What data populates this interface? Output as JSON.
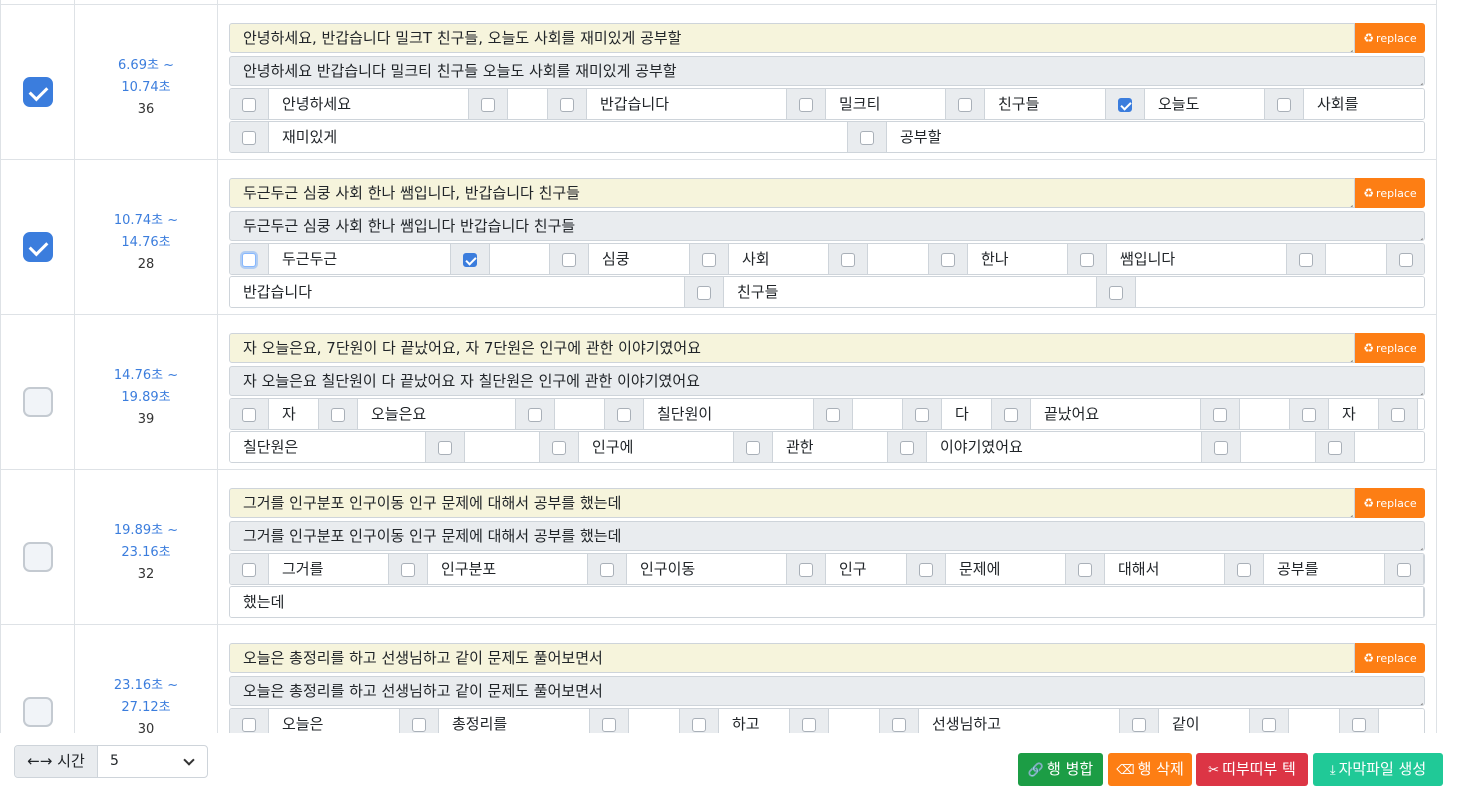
{
  "replace_label": "replace",
  "rows": [
    {
      "checked": false,
      "time_range": "",
      "count": "",
      "source": "",
      "edited": "",
      "lines": []
    },
    {
      "checked": true,
      "time_range": "6.69초 ~",
      "time_end": "10.74초",
      "count": "36",
      "source": "안녕하세요, 반갑습니다 밀크T 친구들, 오늘도 사회를 재미있게 공부할",
      "edited": "안녕하세요 반갑습니다 밀크티 친구들 오늘도 사회를 재미있게 공부할",
      "lines": [
        [
          {
            "w": "안녕하세요",
            "c": false,
            "width": 200
          },
          {
            "w": "",
            "c": false,
            "width": 40
          },
          {
            "w": "반갑습니다",
            "c": false,
            "width": 200
          },
          {
            "w": "밀크티",
            "c": false,
            "width": 120
          },
          {
            "w": "친구들",
            "c": false,
            "width": 121
          },
          {
            "w": "오늘도",
            "c": true,
            "width": 120
          },
          {
            "w": "사회를",
            "c": false,
            "width": 121
          }
        ],
        [
          {
            "w": "재미있게",
            "c": false,
            "width": 579
          },
          {
            "w": "공부할",
            "c": false,
            "width": 539
          }
        ]
      ]
    },
    {
      "checked": true,
      "time_range": "10.74초 ~",
      "time_end": "14.76초",
      "count": "28",
      "source": "두근두근 심쿵 사회 한나 쌤입니다, 반갑습니다 친구들",
      "edited": "두근두근 심쿵 사회 한나 쌤입니다 반갑습니다 친구들",
      "lines": [
        [
          {
            "w": "두근두근",
            "c": false,
            "focus": true,
            "width": 182
          },
          {
            "w": "",
            "c": true,
            "width": 60
          },
          {
            "w": "심쿵",
            "c": false,
            "width": 101
          },
          {
            "w": "사회",
            "c": false,
            "width": 100
          },
          {
            "w": "",
            "c": false,
            "width": 61
          },
          {
            "w": "한나",
            "c": false,
            "width": 100
          },
          {
            "w": "쌤입니다",
            "c": false,
            "width": 180
          },
          {
            "w": "",
            "c": false,
            "width": 61
          },
          {
            "w": "",
            "c": false,
            "width": 0
          }
        ],
        [
          {
            "w": "반갑습니다",
            "c": null,
            "width": 455
          },
          {
            "w": "친구들",
            "c": false,
            "width": 373
          },
          {
            "w": "",
            "c": false,
            "width": 290
          }
        ]
      ]
    },
    {
      "checked": false,
      "time_range": "14.76초 ~",
      "time_end": "19.89초",
      "count": "39",
      "source": "자 오늘은요, 7단원이 다 끝났어요, 자 7단원은 인구에 관한 이야기였어요",
      "edited": "자 오늘은요 칠단원이 다 끝났어요 자 칠단원은 인구에 관한 이야기였어요",
      "lines": [
        [
          {
            "w": "자",
            "c": false,
            "width": 50
          },
          {
            "w": "오늘은요",
            "c": false,
            "width": 158
          },
          {
            "w": "",
            "c": false,
            "width": 50
          },
          {
            "w": "칠단원이",
            "c": false,
            "width": 170
          },
          {
            "w": "",
            "c": false,
            "width": 50
          },
          {
            "w": "다",
            "c": false,
            "width": 50
          },
          {
            "w": "끝났어요",
            "c": false,
            "width": 170
          },
          {
            "w": "",
            "c": false,
            "width": 50
          },
          {
            "w": "자",
            "c": false,
            "width": 50
          },
          {
            "w": "",
            "c": false,
            "width": 0
          }
        ],
        [
          {
            "w": "칠단원은",
            "c": null,
            "width": 196
          },
          {
            "w": "",
            "c": false,
            "width": 75
          },
          {
            "w": "인구에",
            "c": false,
            "width": 155
          },
          {
            "w": "관한",
            "c": false,
            "width": 115
          },
          {
            "w": "이야기였어요",
            "c": false,
            "width": 275
          },
          {
            "w": "",
            "c": false,
            "width": 75
          },
          {
            "w": "",
            "c": false,
            "width": 75
          }
        ]
      ]
    },
    {
      "checked": false,
      "time_range": "19.89초 ~",
      "time_end": "23.16초",
      "count": "32",
      "source": "그거를 인구분포 인구이동 인구 문제에 대해서 공부를 했는데",
      "edited": "그거를 인구분포 인구이동 인구 문제에 대해서 공부를 했는데",
      "lines": [
        [
          {
            "w": "그거를",
            "c": false,
            "width": 120
          },
          {
            "w": "인구분포",
            "c": false,
            "width": 160
          },
          {
            "w": "인구이동",
            "c": false,
            "width": 160
          },
          {
            "w": "인구",
            "c": false,
            "width": 81
          },
          {
            "w": "문제에",
            "c": false,
            "width": 120
          },
          {
            "w": "대해서",
            "c": false,
            "width": 120
          },
          {
            "w": "공부를",
            "c": false,
            "width": 121
          },
          {
            "w": "",
            "c": false,
            "width": 0
          }
        ],
        [
          {
            "w": "했는데",
            "c": null,
            "width": 1194
          }
        ]
      ]
    },
    {
      "checked": false,
      "time_range": "23.16초 ~",
      "time_end": "27.12초",
      "count": "30",
      "source": "오늘은 총정리를 하고 선생님하고 같이 문제도 풀어보면서",
      "edited": "오늘은 총정리를 하고 선생님하고 같이 문제도 풀어보면서",
      "lines": [
        [
          {
            "w": "오늘은",
            "c": false,
            "width": 131
          },
          {
            "w": "총정리를",
            "c": false,
            "width": 151
          },
          {
            "w": "",
            "c": false,
            "width": 51
          },
          {
            "w": "하고",
            "c": false,
            "width": 71
          },
          {
            "w": "",
            "c": false,
            "width": 51
          },
          {
            "w": "선생님하고",
            "c": false,
            "width": 201
          },
          {
            "w": "같이",
            "c": false,
            "width": 91
          },
          {
            "w": "",
            "c": false,
            "width": 51
          },
          {
            "w": "",
            "c": false,
            "width": 0
          }
        ]
      ]
    }
  ],
  "footer": {
    "time_label": "←→ 시간",
    "time_value": "5",
    "merge_label": "행 병합",
    "delete_label": "행 삭제",
    "beep_label": "띠부띠부 텍",
    "generate_label": "자막파일 생성"
  }
}
